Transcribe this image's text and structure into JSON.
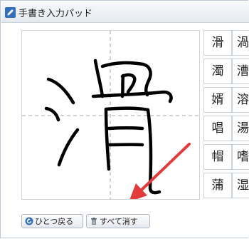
{
  "window": {
    "title": "手書き入力パッド",
    "icon": "pen-icon"
  },
  "candidates": [
    [
      "滑",
      "渦"
    ],
    [
      "濁",
      "漕"
    ],
    [
      "婿",
      "溶"
    ],
    [
      "唱",
      "湯"
    ],
    [
      "帽",
      "嗜"
    ],
    [
      "蒲",
      "湿"
    ]
  ],
  "buttons": {
    "undo_label": "ひとつ戻る",
    "undo_icon": "undo-icon",
    "clear_label": "すべて消す",
    "clear_icon": "trash-icon"
  },
  "colors": {
    "accent": "#2f6fbe",
    "arrow": "#e23b3b",
    "ink": "#000000"
  }
}
